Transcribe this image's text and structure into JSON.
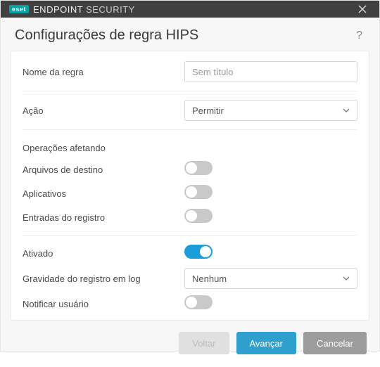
{
  "titlebar": {
    "brand_badge": "eset",
    "brand_main": "ENDPOINT",
    "brand_sub": "SECURITY"
  },
  "header": {
    "title": "Configurações de regra HIPS"
  },
  "fields": {
    "rule_name_label": "Nome da regra",
    "rule_name_placeholder": "Sem título",
    "rule_name_value": "",
    "action_label": "Ação",
    "action_value": "Permitir",
    "operations_section": "Operações afetando",
    "target_files_label": "Arquivos de destino",
    "target_files_on": false,
    "applications_label": "Aplicativos",
    "applications_on": false,
    "registry_entries_label": "Entradas do registro",
    "registry_entries_on": false,
    "enabled_label": "Ativado",
    "enabled_on": true,
    "log_severity_label": "Gravidade do registro em log",
    "log_severity_value": "Nenhum",
    "notify_user_label": "Notificar usuário",
    "notify_user_on": false
  },
  "footer": {
    "back": "Voltar",
    "next": "Avançar",
    "cancel": "Cancelar"
  }
}
